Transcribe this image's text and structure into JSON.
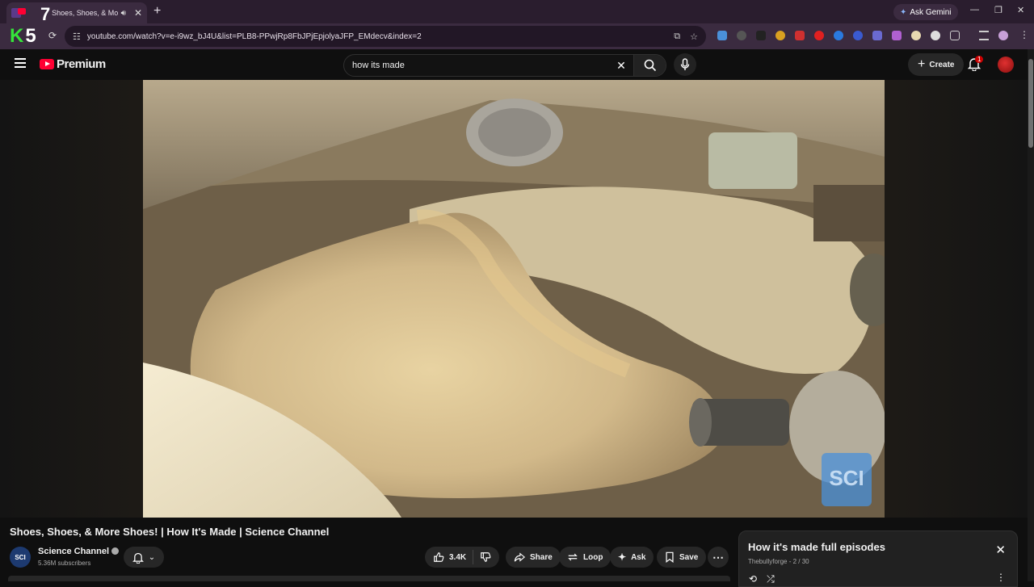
{
  "browser": {
    "tab_title": "Shoes, Shoes, & More S",
    "tab_badge": "7",
    "new_tab_label": "+",
    "ask_gemini_label": "Ask Gemini",
    "profile_logo": {
      "k": "K",
      "num": "5"
    },
    "url": "youtube.com/watch?v=e-i9wz_bJ4U&list=PLB8-PPwjRp8FbJPjEpjolyaJFP_EMdecv&index=2"
  },
  "masthead": {
    "logo_label": "Premium",
    "search_query": "how its made",
    "create_label": "Create",
    "notification_count": "1"
  },
  "video": {
    "title": "Shoes, Shoes, & More Shoes! | How It's Made | Science Channel",
    "watermark": "SCI"
  },
  "channel": {
    "avatar_text": "SCI",
    "name": "Science Channel",
    "subscribers": "5.36M subscribers"
  },
  "actions": {
    "like_count": "3.4K",
    "share_label": "Share",
    "loop_label": "Loop",
    "ask_label": "Ask",
    "save_label": "Save",
    "more_label": "⋯"
  },
  "playlist": {
    "title": "How it's made full episodes",
    "subtitle": "Thebullyforge - 2 / 30"
  },
  "colors": {
    "youtube_red": "#ff0033",
    "browser_frame": "#3b2b40",
    "page_bg": "#0f0f0f",
    "k5_green": "#35e53a"
  }
}
